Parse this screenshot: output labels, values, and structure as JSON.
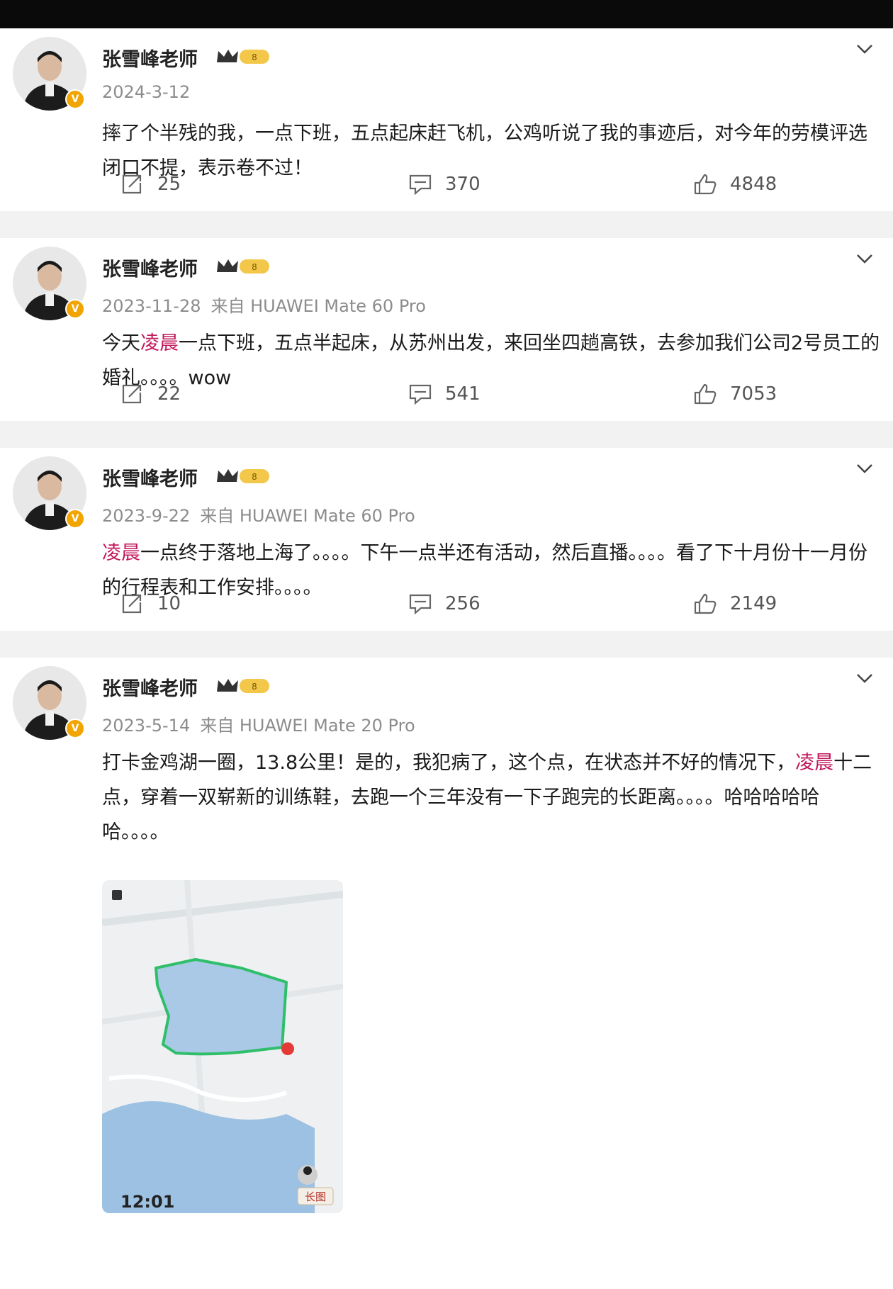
{
  "posts": [
    {
      "author": "张雪峰老师",
      "date": "2024-3-12",
      "source": "",
      "content_segments": [
        {
          "text": "摔了个半残的我，一点下班，五点起床赶飞机，公鸡听说了我的事迹后，对今年的劳模评选闭口不提，表示卷不过！",
          "highlight": false
        }
      ],
      "reposts": "25",
      "comments": "370",
      "likes": "4848"
    },
    {
      "author": "张雪峰老师",
      "date": "2023-11-28",
      "source": "来自 HUAWEI Mate 60 Pro",
      "content_segments": [
        {
          "text": "今天",
          "highlight": false
        },
        {
          "text": "凌晨",
          "highlight": true
        },
        {
          "text": "一点下班，五点半起床，从苏州出发，来回坐四趟高铁，去参加我们公司2号员工的婚礼。。。。wow",
          "highlight": false
        }
      ],
      "reposts": "22",
      "comments": "541",
      "likes": "7053"
    },
    {
      "author": "张雪峰老师",
      "date": "2023-9-22",
      "source": "来自 HUAWEI Mate 60 Pro",
      "content_segments": [
        {
          "text": "凌晨",
          "highlight": true
        },
        {
          "text": "一点终于落地上海了。。。。下午一点半还有活动，然后直播。。。。看了下十月份十一月份的行程表和工作安排。。。。",
          "highlight": false
        }
      ],
      "reposts": "10",
      "comments": "256",
      "likes": "2149"
    },
    {
      "author": "张雪峰老师",
      "date": "2023-5-14",
      "source": "来自 HUAWEI Mate 20 Pro",
      "content_segments": [
        {
          "text": "打卡金鸡湖一圈，13.8公里！是的，我犯病了，这个点，在状态并不好的情况下，",
          "highlight": false
        },
        {
          "text": "凌晨",
          "highlight": true
        },
        {
          "text": "十二点，穿着一双崭新的训练鞋，去跑一个三年没有一下子跑完的长距离。。。。哈哈哈哈哈哈。。。。",
          "highlight": false
        }
      ],
      "map_time_label": "12:01",
      "map_badge_label": "长图"
    }
  ],
  "colors": {
    "highlight": "#c2185b",
    "vip_badge": "#f2a400",
    "route": "#2fbf6b"
  },
  "icons": {
    "repost": "repost-icon",
    "comment": "comment-icon",
    "like": "thumbs-up-icon",
    "more": "chevron-down-icon",
    "verified": "verified-badge-icon",
    "crown": "crown-icon"
  }
}
